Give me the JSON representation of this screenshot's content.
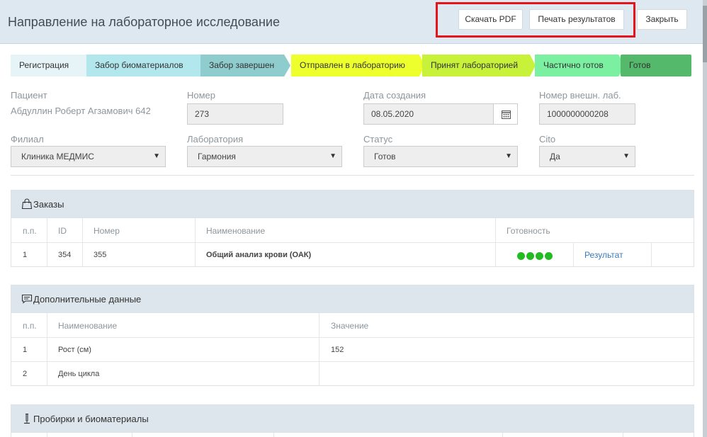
{
  "header": {
    "title": "Направление на лабораторное исследование",
    "download_pdf": "Скачать PDF",
    "print_results": "Печать результатов",
    "close": "Закрыть"
  },
  "steps": [
    {
      "label": "Регистрация",
      "color": "#e6f3f7"
    },
    {
      "label": "Забор биоматериалов",
      "color": "#b3e7ee"
    },
    {
      "label": "Забор завершен",
      "color": "#8fccce"
    },
    {
      "label": "Отправлен в лабораторию",
      "color": "#eeff2e"
    },
    {
      "label": "Принят лабораторией",
      "color": "#c8f23a"
    },
    {
      "label": "Частично готов",
      "color": "#7af0a0"
    },
    {
      "label": "Готов",
      "color": "#54b96a"
    }
  ],
  "form": {
    "patient_label": "Пациент",
    "patient_value": "Абдуллин Роберт Агзамович 642",
    "number_label": "Номер",
    "number_value": "273",
    "created_label": "Дата создания",
    "created_value": "08.05.2020",
    "ext_number_label": "Номер внешн. лаб.",
    "ext_number_value": "1000000000208",
    "branch_label": "Филиал",
    "branch_value": "Клиника МЕДМИС",
    "lab_label": "Лаборатория",
    "lab_value": "Гармония",
    "status_label": "Статус",
    "status_value": "Готов",
    "cito_label": "Cito",
    "cito_value": "Да"
  },
  "orders": {
    "title": "Заказы",
    "headers": [
      "п.п.",
      "ID",
      "Номер",
      "Наименование",
      "Готовность"
    ],
    "rows": [
      {
        "pp": "1",
        "id": "354",
        "number": "355",
        "name": "Общий анализ крови (ОАК)",
        "readiness_dots": 4,
        "result_link": "Результат"
      }
    ]
  },
  "extra": {
    "title": "Дополнительные данные",
    "headers": [
      "п.п.",
      "Наименование",
      "Значение"
    ],
    "rows": [
      {
        "pp": "1",
        "name": "Рост (см)",
        "value": "152"
      },
      {
        "pp": "2",
        "name": "День цикла",
        "value": ""
      }
    ]
  },
  "tubes": {
    "title": "Пробирки и биоматериалы"
  },
  "colors": {
    "accent_link": "#3a7ab8",
    "ready_dot": "#22bb22",
    "highlight": "#e8141c"
  }
}
